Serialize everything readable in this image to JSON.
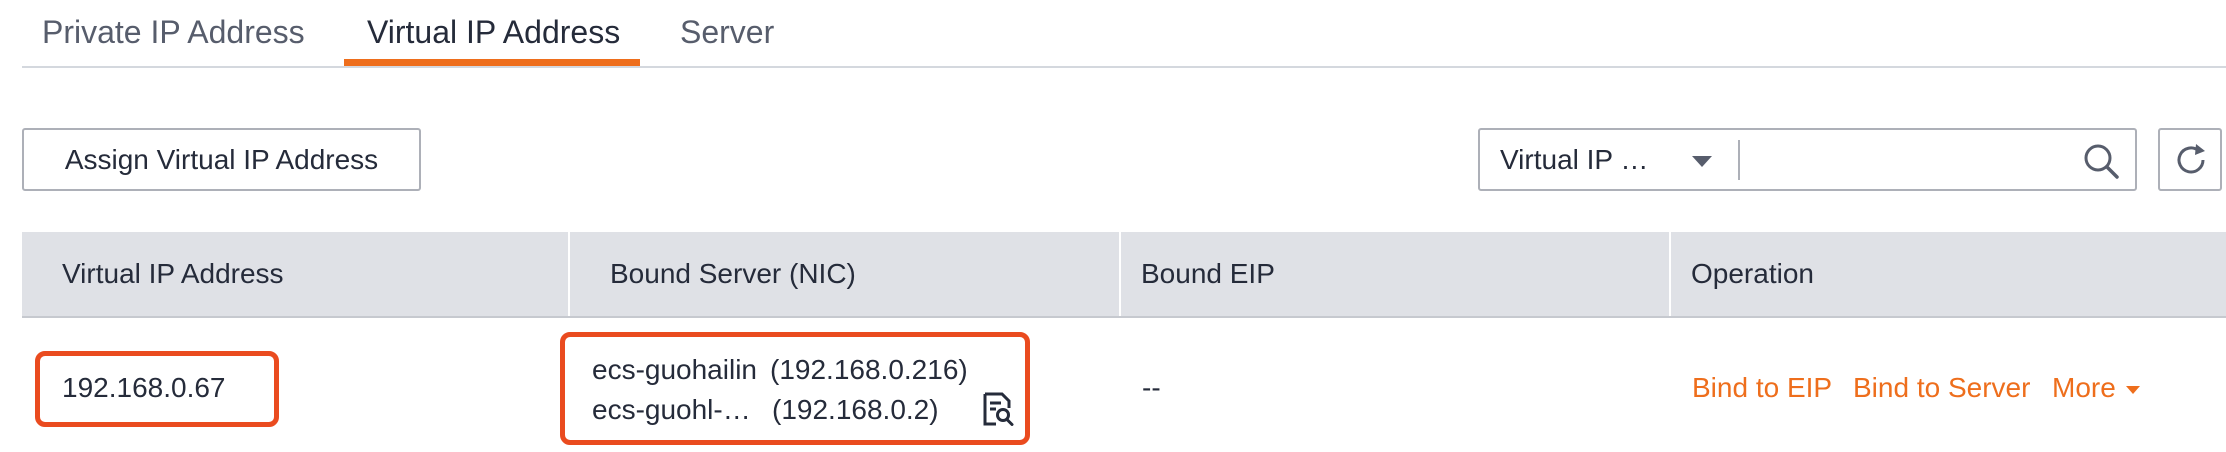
{
  "tabs": [
    {
      "label": "Private IP Address",
      "active": false
    },
    {
      "label": "Virtual IP Address",
      "active": true
    },
    {
      "label": "Server",
      "active": false
    }
  ],
  "toolbar": {
    "assign_label": "Assign Virtual IP Address",
    "filter_select": "Virtual IP …",
    "search_value": "",
    "search_icon": "search-icon",
    "refresh_icon": "refresh-icon"
  },
  "table": {
    "columns": [
      "Virtual IP Address",
      "Bound Server (NIC)",
      "Bound EIP",
      "Operation"
    ],
    "rows": [
      {
        "virtual_ip": "192.168.0.67",
        "servers": [
          {
            "name": "ecs-guohailin",
            "ip": "(192.168.0.216)"
          },
          {
            "name": "ecs-guohl-…",
            "ip": "(192.168.0.2)"
          }
        ],
        "bound_eip": "--",
        "operations": {
          "bind_eip": "Bind to EIP",
          "bind_server": "Bind to Server",
          "more": "More"
        }
      }
    ]
  },
  "colors": {
    "accent": "#ee6e1c",
    "highlight": "#ea4b1f",
    "header_bg": "#dfe1e6"
  }
}
